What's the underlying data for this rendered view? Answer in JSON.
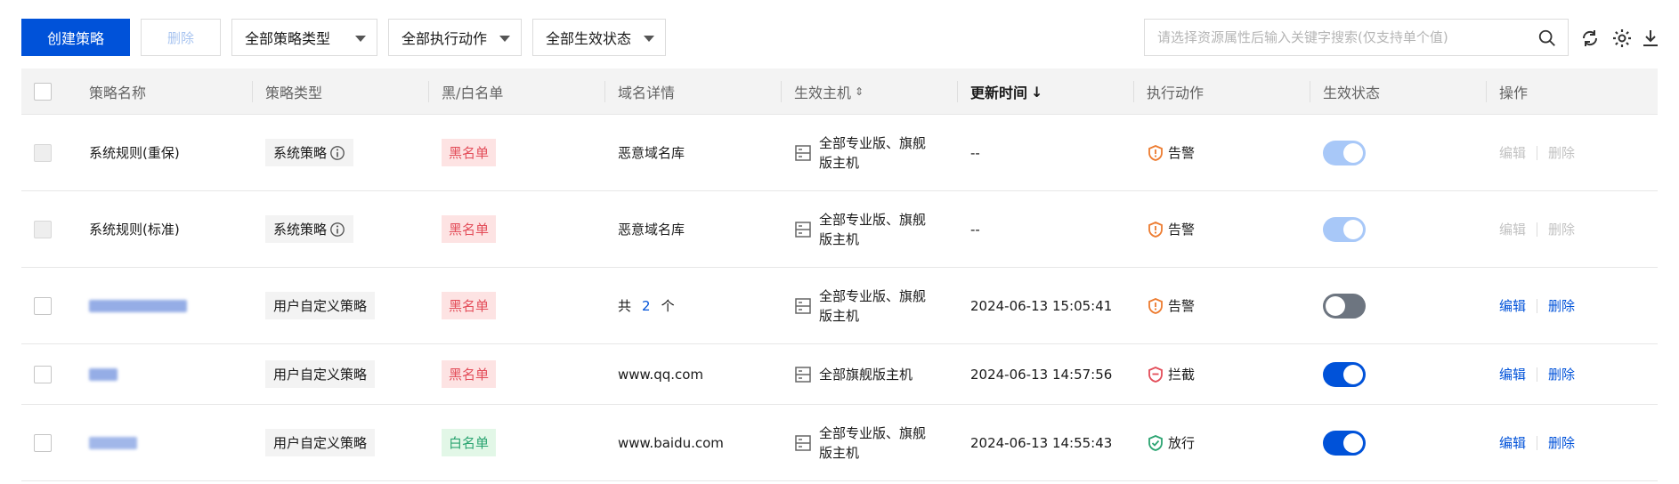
{
  "toolbar": {
    "create_label": "创建策略",
    "delete_label": "删除",
    "filter_policy_type": "全部策略类型",
    "filter_action": "全部执行动作",
    "filter_status": "全部生效状态",
    "search_placeholder": "请选择资源属性后输入关键字搜索(仅支持单个值)"
  },
  "table": {
    "headers": {
      "name": "策略名称",
      "type": "策略类型",
      "list": "黑/白名单",
      "domain": "域名详情",
      "host": "生效主机",
      "updated": "更新时间",
      "action": "执行动作",
      "status": "生效状态",
      "ops": "操作"
    },
    "sort_up_down": "⇕",
    "sort_down": "↓",
    "rows": [
      {
        "name": "系统规则(重保)",
        "type": "系统策略",
        "list": "黑名单",
        "list_kind": "black",
        "domain": "恶意域名库",
        "host": "全部专业版、旗舰版主机",
        "updated": "--",
        "action": "告警",
        "action_kind": "alert",
        "status": "on-disabled",
        "edit": "编辑",
        "delete": "删除",
        "ops_enabled": false,
        "checkbox_disabled": true
      },
      {
        "name": "系统规则(标准)",
        "type": "系统策略",
        "list": "黑名单",
        "list_kind": "black",
        "domain": "恶意域名库",
        "host": "全部专业版、旗舰版主机",
        "updated": "--",
        "action": "告警",
        "action_kind": "alert",
        "status": "on-disabled",
        "edit": "编辑",
        "delete": "删除",
        "ops_enabled": false,
        "checkbox_disabled": true
      },
      {
        "name": "",
        "type": "用户自定义策略",
        "list": "黑名单",
        "list_kind": "black",
        "domain_prefix": "共",
        "domain_count": "2",
        "domain_suffix": "个",
        "host": "全部专业版、旗舰版主机",
        "updated": "2024-06-13 15:05:41",
        "action": "告警",
        "action_kind": "alert",
        "status": "off",
        "edit": "编辑",
        "delete": "删除",
        "ops_enabled": true,
        "checkbox_disabled": false
      },
      {
        "name": "",
        "type": "用户自定义策略",
        "list": "黑名单",
        "list_kind": "black",
        "domain": "www.qq.com",
        "host": "全部旗舰版主机",
        "updated": "2024-06-13 14:57:56",
        "action": "拦截",
        "action_kind": "block",
        "status": "on",
        "edit": "编辑",
        "delete": "删除",
        "ops_enabled": true,
        "checkbox_disabled": false
      },
      {
        "name": "",
        "type": "用户自定义策略",
        "list": "白名单",
        "list_kind": "white",
        "domain": "www.baidu.com",
        "host": "全部专业版、旗舰版主机",
        "updated": "2024-06-13 14:55:43",
        "action": "放行",
        "action_kind": "allow",
        "status": "on",
        "edit": "编辑",
        "delete": "删除",
        "ops_enabled": true,
        "checkbox_disabled": false
      }
    ]
  },
  "colors": {
    "primary": "#0052d9",
    "alert": "#ed7b2f",
    "block": "#e34d59",
    "allow": "#2ba471"
  }
}
